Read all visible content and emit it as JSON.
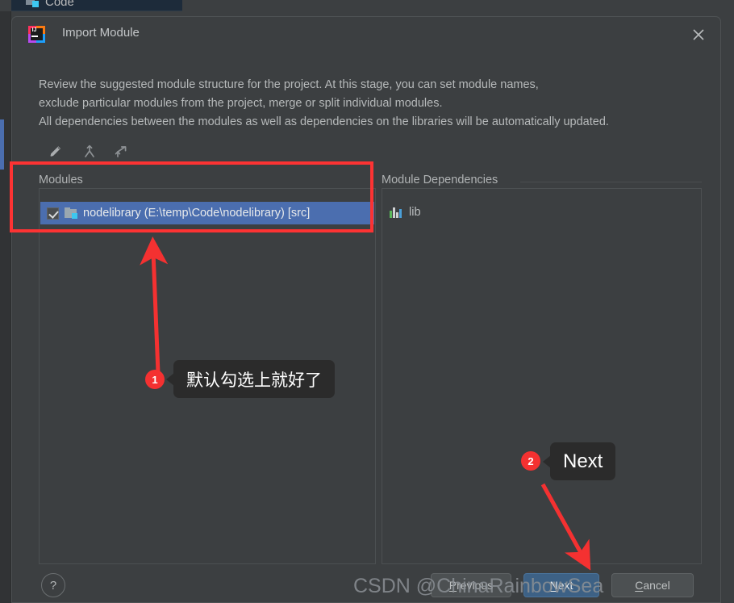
{
  "background": {
    "tab_label": "Code",
    "tab_icon": "module-icon"
  },
  "dialog": {
    "title": "Import Module",
    "app_icon": "intellij-idea-icon",
    "close_icon": "close-icon",
    "description": [
      "Review the suggested module structure for the project. At this stage, you can set module names,",
      "exclude particular modules from the project, merge or split individual modules.",
      "All dependencies between the modules as well as dependencies on the libraries will be automatically updated."
    ],
    "toolbar": [
      {
        "name": "edit-icon",
        "title": "Edit"
      },
      {
        "name": "merge-icon",
        "title": "Merge"
      },
      {
        "name": "split-icon",
        "title": "Split"
      }
    ],
    "modules_panel": {
      "label": "Modules",
      "rows": [
        {
          "checked": true,
          "icon": "module-folder-icon",
          "label": "nodelibrary (E:\\temp\\Code\\nodelibrary) [src]",
          "selected": true
        }
      ]
    },
    "dependencies_panel": {
      "label": "Module Dependencies",
      "rows": [
        {
          "icon": "library-icon",
          "label": "lib"
        }
      ]
    },
    "footer": {
      "help_label": "?",
      "buttons": [
        {
          "name": "previous-button",
          "label": "Previous",
          "mnemonic": "P",
          "style": "default"
        },
        {
          "name": "next-button",
          "label": "Next",
          "mnemonic": "N",
          "style": "primary"
        },
        {
          "name": "cancel-button",
          "label": "Cancel",
          "mnemonic": "C",
          "style": "default"
        }
      ]
    }
  },
  "annotations": {
    "accent_color": "#f43131",
    "callouts": [
      {
        "badge": "1",
        "text": "默认勾选上就好了"
      },
      {
        "badge": "2",
        "text": "Next"
      }
    ]
  },
  "watermark": "CSDN @ChinaRainbowSea"
}
